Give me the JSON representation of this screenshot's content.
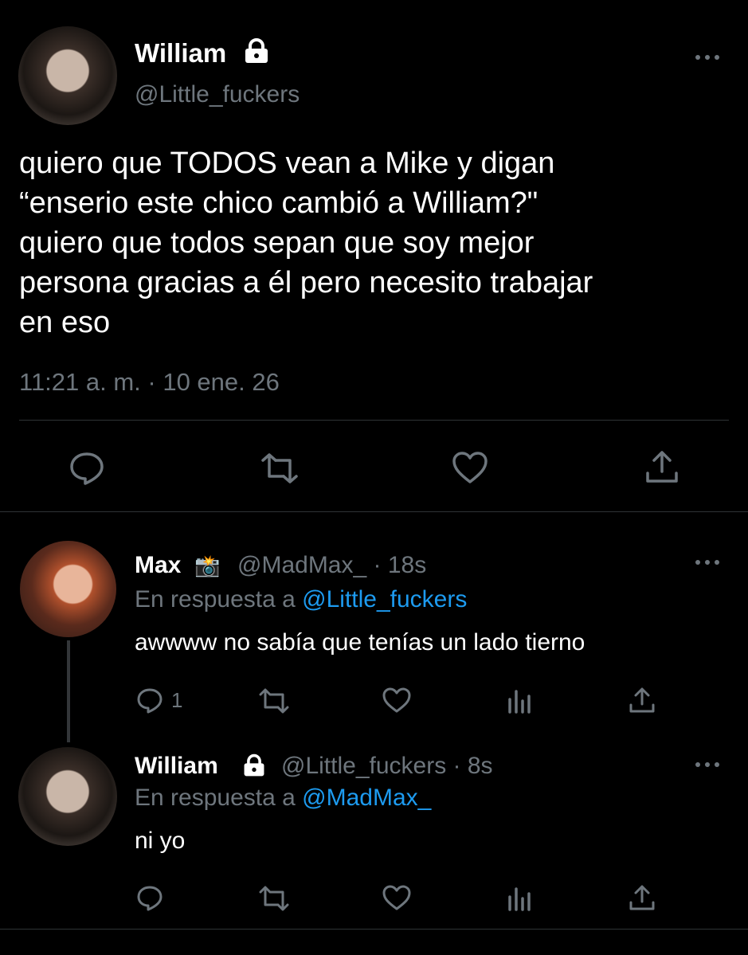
{
  "main_tweet": {
    "display_name": "William",
    "handle": "@Little_fuckers",
    "text_lines": [
      "quiero que TODOS vean a Mike y digan",
      "“enserio este chico cambió a William?\"",
      "quiero que todos sepan que soy mejor",
      "persona gracias a él pero necesito trabajar",
      "en eso"
    ],
    "timestamp": "11:21 a. m. · 10 ene. 26"
  },
  "replies": [
    {
      "display_name": "Max",
      "badge_emoji": "📸",
      "handle_time": "@MadMax_ · 18s",
      "reply_prefix": "En respuesta a",
      "reply_to": "@Little_fuckers",
      "text": "awwww no sabía que tenías un lado tierno",
      "reply_count": "1"
    },
    {
      "display_name": "William",
      "handle_time": "@Little_fuckers · 8s",
      "reply_prefix": "En respuesta a",
      "reply_to": "@MadMax_",
      "text": "ni yo"
    }
  ],
  "colors": {
    "background": "#000000",
    "muted": "#6e767d",
    "link": "#1d9bf0",
    "divider": "#2f3336"
  }
}
